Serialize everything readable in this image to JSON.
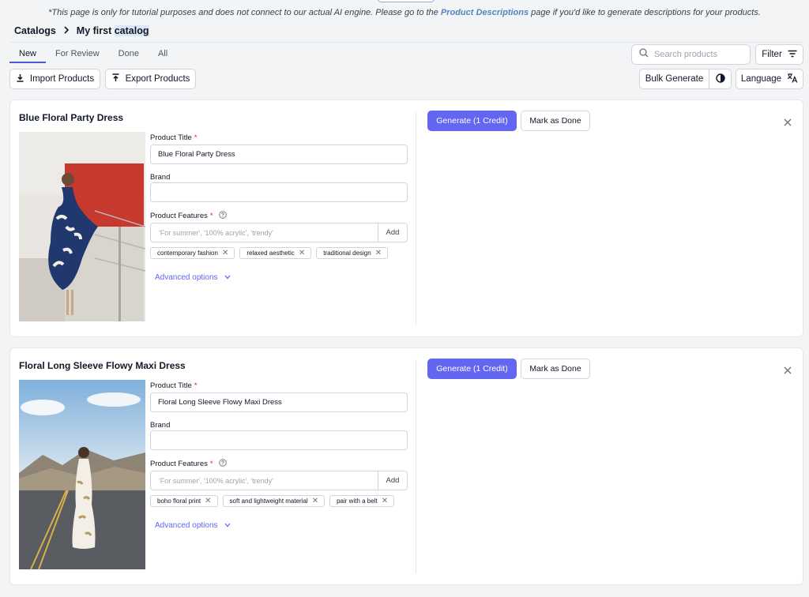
{
  "notice": {
    "before": "*This page is only for tutorial purposes and does not connect to our actual AI engine. Please go to the ",
    "link": "Product Descriptions",
    "after": " page if you'd like to generate descriptions for your products."
  },
  "breadcrumb": {
    "root": "Catalogs",
    "current_prefix": "My first ",
    "current_highlight": "catalog"
  },
  "tabs": [
    {
      "label": "New"
    },
    {
      "label": "For Review"
    },
    {
      "label": "Done"
    },
    {
      "label": "All"
    }
  ],
  "toolbar": {
    "import_label": "Import Products",
    "export_label": "Export Products",
    "search_placeholder": "Search products",
    "filter_label": "Filter",
    "bulk_generate_label": "Bulk Generate",
    "language_label": "Language"
  },
  "products": [
    {
      "title": "Blue Floral Party Dress",
      "product_title_label": "Product Title",
      "product_title_value": "Blue Floral Party Dress",
      "brand_label": "Brand",
      "brand_value": "",
      "features_label": "Product Features",
      "features_placeholder": "'For summer', '100% acrylic', 'trendy'",
      "add_label": "Add",
      "features": [
        "contemporary fashion",
        "relaxed aesthetic",
        "traditional design"
      ],
      "advanced_label": "Advanced options",
      "generate_label": "Generate (1 Credit)",
      "done_label": "Mark as Done"
    },
    {
      "title": "Floral Long Sleeve Flowy Maxi Dress",
      "product_title_label": "Product Title",
      "product_title_value": "Floral Long Sleeve Flowy Maxi Dress",
      "brand_label": "Brand",
      "brand_value": "",
      "features_label": "Product Features",
      "features_placeholder": "'For summer', '100% acrylic', 'trendy'",
      "add_label": "Add",
      "features": [
        "boho floral print",
        "soft and lightweight material",
        "pair with a belt"
      ],
      "advanced_label": "Advanced options",
      "generate_label": "Generate (1 Credit)",
      "done_label": "Mark as Done"
    }
  ],
  "colors": {
    "accent": "#6366f1",
    "link": "#4f86c6",
    "required": "#dc2626"
  }
}
